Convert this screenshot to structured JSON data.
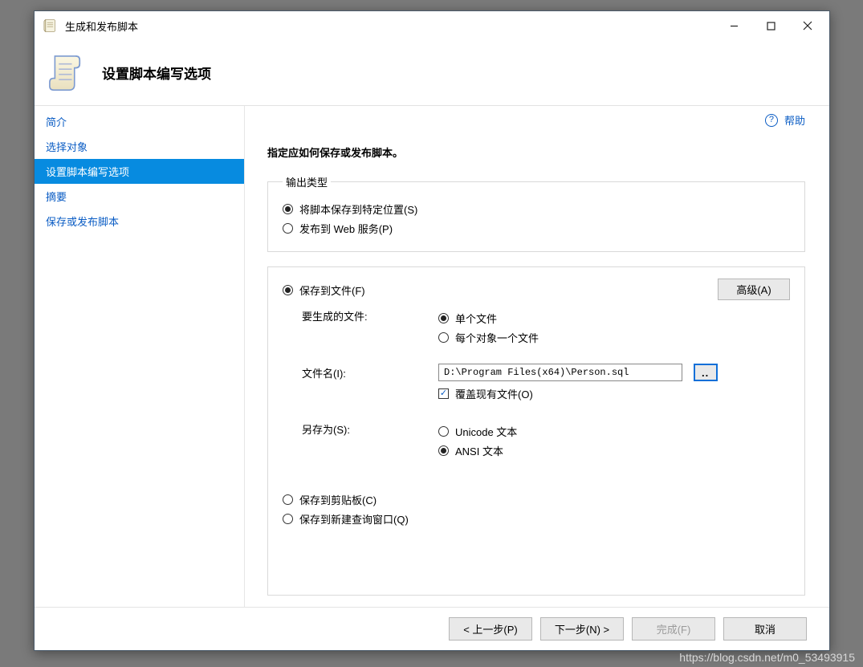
{
  "window": {
    "title": "生成和发布脚本"
  },
  "header": {
    "title": "设置脚本编写选项"
  },
  "sidebar": {
    "items": [
      {
        "label": "简介"
      },
      {
        "label": "选择对象"
      },
      {
        "label": "设置脚本编写选项"
      },
      {
        "label": "摘要"
      },
      {
        "label": "保存或发布脚本"
      }
    ],
    "active_index": 2
  },
  "help": {
    "label": "帮助"
  },
  "content": {
    "instruction": "指定应如何保存或发布脚本。",
    "output_type": {
      "legend": "输出类型",
      "save_specific": "将脚本保存到特定位置(S)",
      "publish_web": "发布到 Web 服务(P)"
    },
    "save_to_file": {
      "label": "保存到文件(F)",
      "advanced_btn": "高级(A)",
      "files_to_gen_label": "要生成的文件:",
      "single_file": "单个文件",
      "per_object": "每个对象一个文件",
      "filename_label": "文件名(I):",
      "filename_value": "D:\\Program Files(x64)\\Person.sql",
      "browse_label": "..",
      "overwrite": "覆盖现有文件(O)",
      "save_as_label": "另存为(S):",
      "unicode": "Unicode 文本",
      "ansi": "ANSI 文本"
    },
    "save_clipboard": "保存到剪贴板(C)",
    "save_new_query": "保存到新建查询窗口(Q)"
  },
  "footer": {
    "prev": "< 上一步(P)",
    "next": "下一步(N) >",
    "finish": "完成(F)",
    "cancel": "取消"
  },
  "watermark": "https://blog.csdn.net/m0_53493915"
}
